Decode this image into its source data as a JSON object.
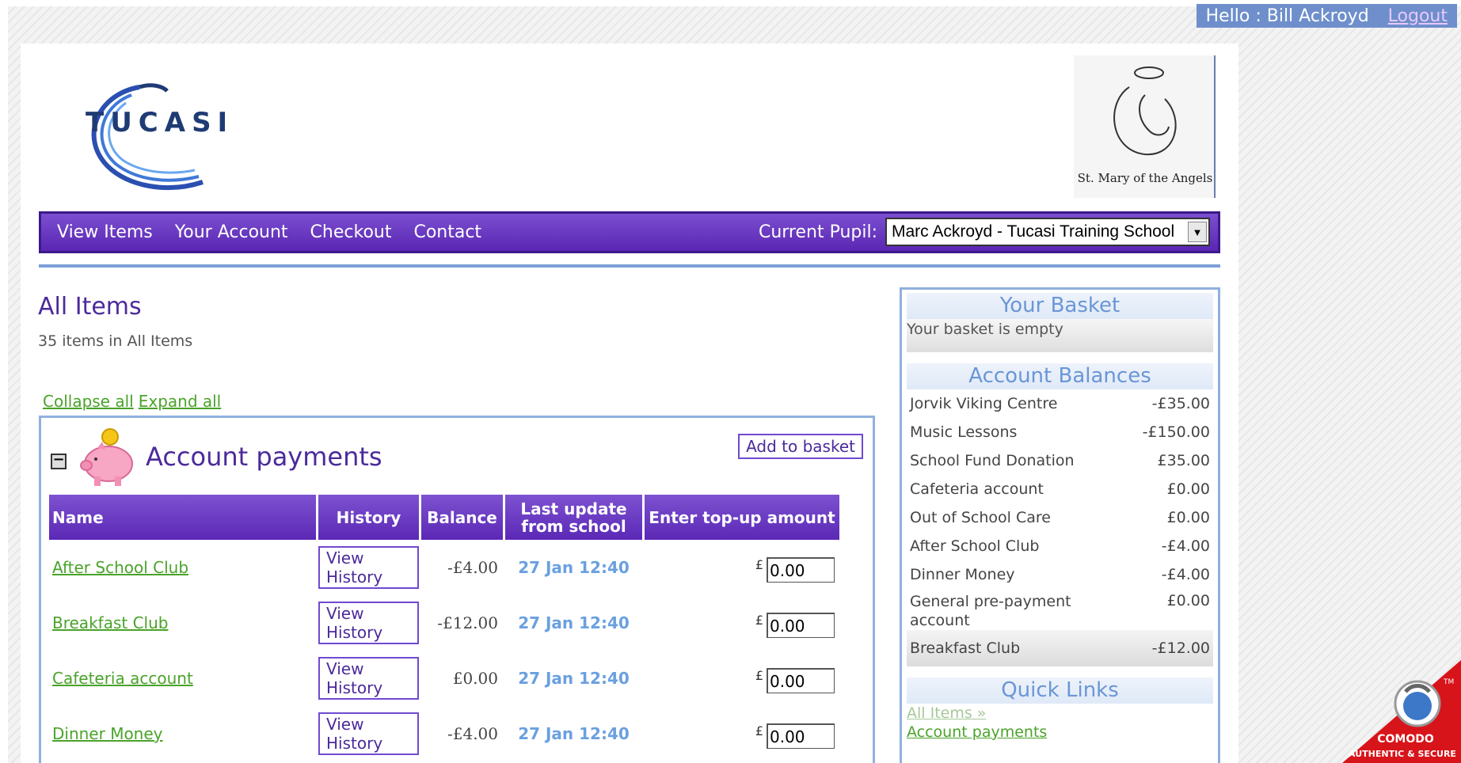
{
  "topbar": {
    "greeting": "Hello : Bill Ackroyd",
    "logout": "Logout"
  },
  "header": {
    "logo_text": "TUCASI",
    "crest_text": "St. Mary of the Angels"
  },
  "nav": {
    "items": [
      "View Items",
      "Your Account",
      "Checkout",
      "Contact"
    ],
    "pupil_label": "Current Pupil:",
    "pupil_value": "Marc Ackroyd - Tucasi Training School"
  },
  "main": {
    "title": "All Items",
    "count": "35 items in All Items",
    "collapse_all": "Collapse all",
    "expand_all": "Expand all"
  },
  "section": {
    "title": "Account payments",
    "add_to_basket": "Add to basket",
    "columns": [
      "Name",
      "History",
      "Balance",
      "Last update from school",
      "Enter top-up amount"
    ],
    "rows": [
      {
        "name": "After School Club",
        "history": "View History",
        "balance": "-£4.00",
        "updated": "27 Jan 12:40",
        "currency": "£",
        "amount": "0.00"
      },
      {
        "name": "Breakfast Club",
        "history": "View History",
        "balance": "-£12.00",
        "updated": "27 Jan 12:40",
        "currency": "£",
        "amount": "0.00"
      },
      {
        "name": "Cafeteria account",
        "history": "View History",
        "balance": "£0.00",
        "updated": "27 Jan 12:40",
        "currency": "£",
        "amount": "0.00"
      },
      {
        "name": "Dinner Money",
        "history": "View History",
        "balance": "-£4.00",
        "updated": "27 Jan 12:40",
        "currency": "£",
        "amount": "0.00"
      }
    ]
  },
  "sidebar": {
    "basket_title": "Your Basket",
    "basket_empty": "Your basket is empty",
    "balances_title": "Account Balances",
    "balances": [
      {
        "name": "Jorvik Viking Centre",
        "amount": "-£35.00"
      },
      {
        "name": "Music Lessons",
        "amount": "-£150.00"
      },
      {
        "name": "School Fund Donation",
        "amount": "£35.00"
      },
      {
        "name": "Cafeteria account",
        "amount": "£0.00"
      },
      {
        "name": "Out of School Care",
        "amount": "£0.00"
      },
      {
        "name": "After School Club",
        "amount": "-£4.00"
      },
      {
        "name": "Dinner Money",
        "amount": "-£4.00"
      },
      {
        "name": "General pre-payment account",
        "amount": "£0.00"
      },
      {
        "name": "Breakfast Club",
        "amount": "-£12.00"
      }
    ],
    "quick_links_title": "Quick Links",
    "quick_links": [
      "All Items »",
      "Account payments"
    ]
  },
  "badge": {
    "brand": "COMODO",
    "tagline": "AUTHENTIC & SECURE",
    "tm": "TM"
  },
  "colors": {
    "nav_purple": "#5a26b3",
    "link_green": "#4aa32a",
    "accent_blue": "#6a96d6"
  }
}
